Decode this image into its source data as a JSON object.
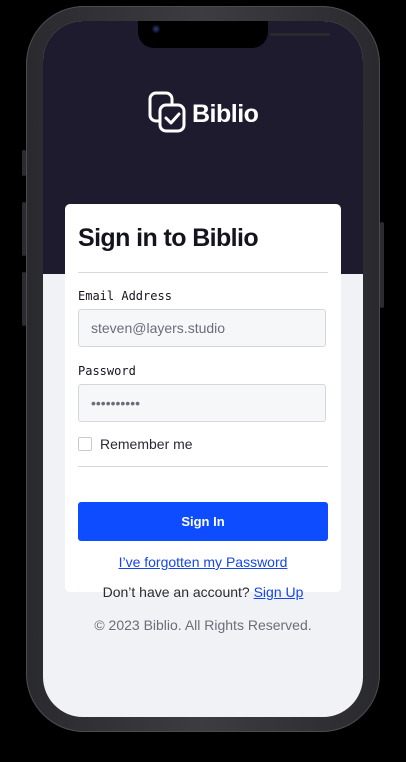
{
  "app": {
    "brand_name": "Biblio"
  },
  "form": {
    "title": "Sign in to Biblio",
    "email_label": "Email Address",
    "email_value": "steven@layers.studio",
    "password_label": "Password",
    "password_value": "••••••••••",
    "remember_label": "Remember me",
    "remember_checked": false,
    "signin_label": "Sign In",
    "forgot_label": "I’ve forgotten my Password",
    "signup_prompt": "Don’t have an account?",
    "signup_link": "Sign Up"
  },
  "footer": {
    "copyright": "© 2023 Biblio. All Rights Reserved."
  },
  "colors": {
    "hero_bg": "#1e1b2e",
    "primary": "#0d4dff",
    "link": "#1546e8",
    "page_bg": "#f1f2f6"
  },
  "icons": {
    "logo": "book-check-icon"
  }
}
